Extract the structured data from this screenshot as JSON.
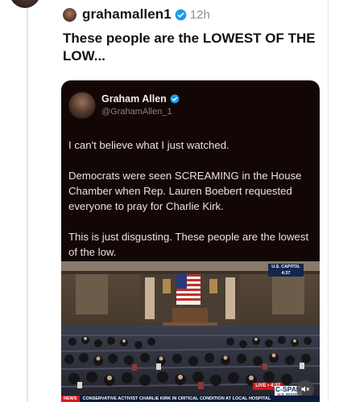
{
  "tweet": {
    "username": "grahamallen1",
    "time": "12h",
    "text": "These people are the LOWEST OF THE LOW...",
    "verified_color": "#1d9bf0"
  },
  "quoted": {
    "name": "Graham Allen",
    "handle": "@GrahamAllen_1",
    "paragraphs": [
      "I can't believe what I just watched.",
      "Democrats were seen SCREAMING in the House Chamber when Rep. Lauren Boebert requested everyone to pray for Charlie Kirk.",
      "This is just disgusting. These people are the lowest of the low."
    ]
  },
  "video": {
    "capitol_label": "U.S. CAPITOL",
    "capitol_time": "4:37",
    "live_label": "LIVE • 4:37",
    "network": "C-SPAN",
    "network_sub": "U.S. HOUSE",
    "ticker_label": "NEWS",
    "ticker_text": "CONSERVATIVE ACTIVIST CHARLIE KIRK IN CRITICAL CONDITION AT LOCAL HOSPITAL",
    "mute_icon": "speaker-muted-icon"
  }
}
